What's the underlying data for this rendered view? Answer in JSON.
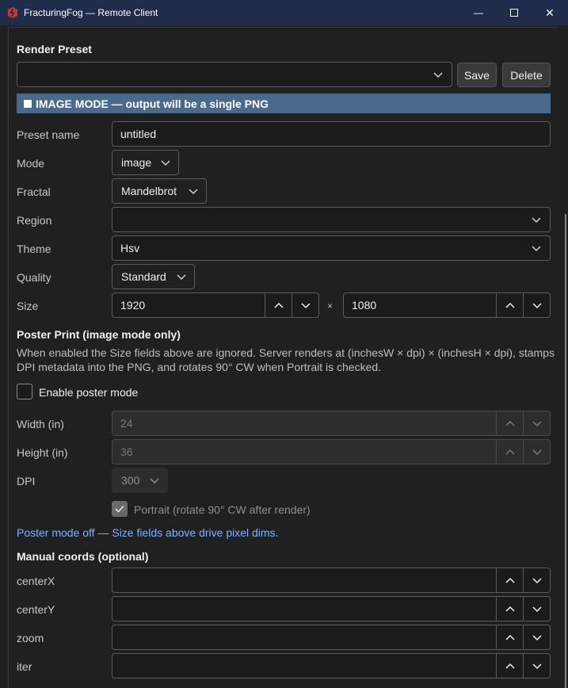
{
  "window": {
    "title": "FracturingFog — Remote Client",
    "minimize_glyph": "—",
    "close_glyph": "✕"
  },
  "render_preset": {
    "title": "Render Preset",
    "selected": "",
    "save_label": "Save",
    "delete_label": "Delete"
  },
  "banner": {
    "text": "IMAGE MODE — output will be a single PNG",
    "color": "#4a6a8b"
  },
  "form": {
    "preset_name": {
      "label": "Preset name",
      "value": "untitled"
    },
    "mode": {
      "label": "Mode",
      "value": "image"
    },
    "fractal": {
      "label": "Fractal",
      "value": "Mandelbrot"
    },
    "region": {
      "label": "Region",
      "value": ""
    },
    "theme": {
      "label": "Theme",
      "value": "Hsv"
    },
    "quality": {
      "label": "Quality",
      "value": "Standard"
    },
    "size": {
      "label": "Size",
      "width": "1920",
      "height": "1080",
      "separator": "×"
    }
  },
  "poster": {
    "title": "Poster Print (image mode only)",
    "description": "When enabled the Size fields above are ignored. Server renders at (inchesW × dpi) × (inchesH × dpi), stamps DPI metadata into the PNG, and rotates 90° CW when Portrait is checked.",
    "enable_label": "Enable poster mode",
    "enabled": false,
    "width_label": "Width (in)",
    "width_value": "24",
    "height_label": "Height (in)",
    "height_value": "36",
    "dpi_label": "DPI",
    "dpi_value": "300",
    "portrait_label": "Portrait (rotate 90° CW after render)",
    "portrait_checked": true,
    "status": "Poster mode off — Size fields above drive pixel dims."
  },
  "manual_coords": {
    "title": "Manual coords (optional)",
    "fields": [
      {
        "label": "centerX",
        "value": ""
      },
      {
        "label": "centerY",
        "value": ""
      },
      {
        "label": "zoom",
        "value": ""
      },
      {
        "label": "iter",
        "value": ""
      }
    ]
  }
}
